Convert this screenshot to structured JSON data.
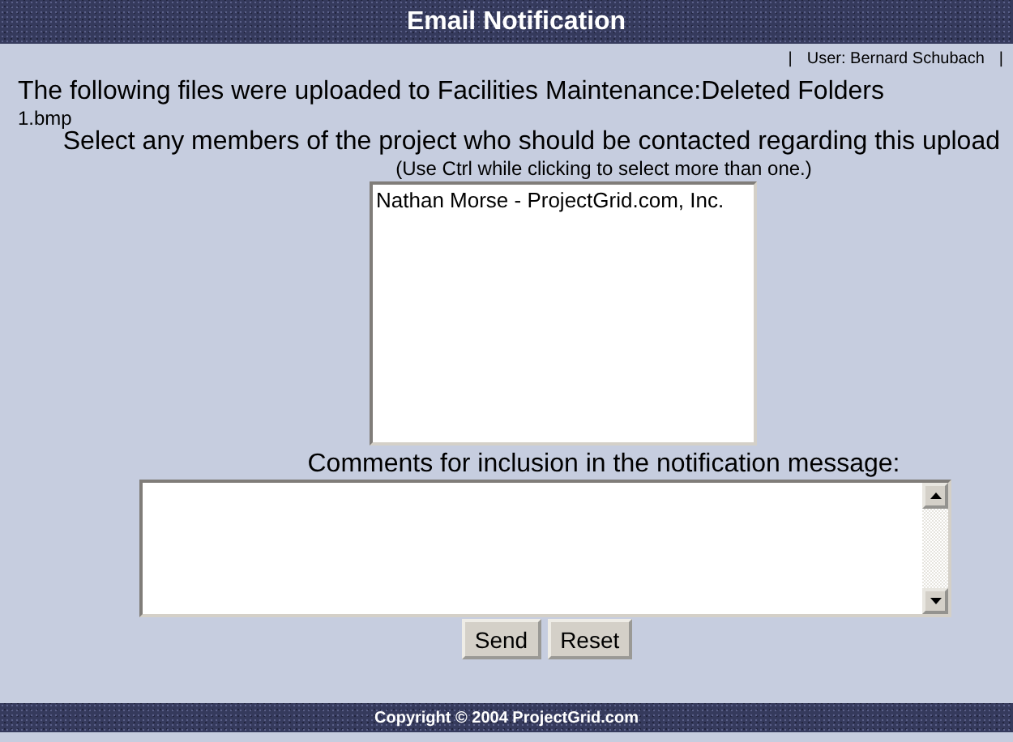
{
  "header": {
    "title": "Email Notification"
  },
  "user_bar": {
    "left_separator": "|",
    "user": "User: Bernard Schubach",
    "right_separator": "|"
  },
  "upload_message": "The following files were uploaded to Facilities Maintenance:Deleted Folders",
  "files": [
    "1.bmp"
  ],
  "members_prompt": "Select any members of the project who should be contacted regarding this upload",
  "members_hint": "(Use Ctrl while clicking to select more than one.)",
  "members": [
    {
      "name": "Nathan Morse - ProjectGrid.com, Inc.",
      "selected": false
    }
  ],
  "comments_label": "Comments for inclusion in the notification message:",
  "buttons": [
    "Send",
    "Reset"
  ],
  "footer": {
    "copyright": "Copyright © 2004 ProjectGrid.com"
  }
}
